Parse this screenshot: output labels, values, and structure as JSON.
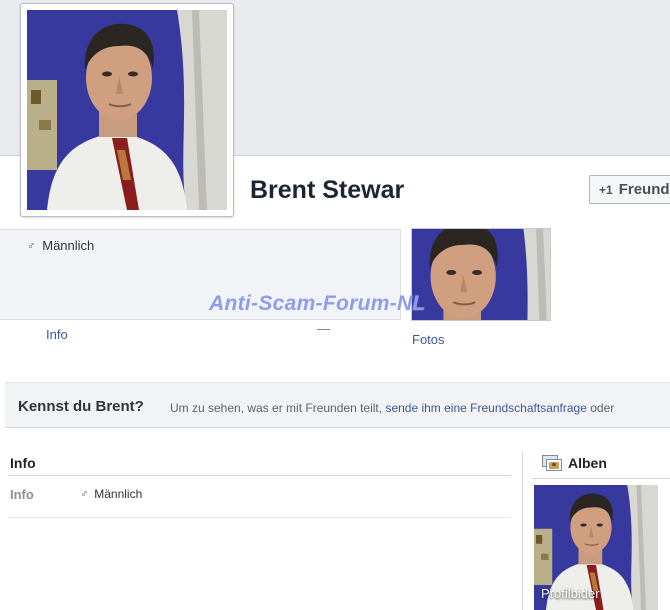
{
  "profile": {
    "name": "Brent Stewar",
    "gender": "Männlich"
  },
  "header": {
    "friend_button_label": "Freund",
    "friend_button_icon": "+1"
  },
  "tabs": {
    "info": "Info",
    "fotos": "Fotos"
  },
  "watermark": "Anti-Scam-Forum-NL",
  "kennst": {
    "title": "Kennst du Brent?",
    "text_before": "Um zu sehen, was er mit Freunden teilt,",
    "link": "sende ihm eine Freundschaftsanfrage",
    "text_after": "oder"
  },
  "info_section": {
    "heading": "Info",
    "label": "Info",
    "gender": "Männlich"
  },
  "albums": {
    "heading": "Alben",
    "caption": "Profilbider"
  },
  "icons": [
    "male-icon",
    "add-friend-icon",
    "albums-icon"
  ],
  "colors": {
    "link": "#3b5998",
    "watermark": "#788ceb",
    "wall": "#3a3a9c"
  }
}
